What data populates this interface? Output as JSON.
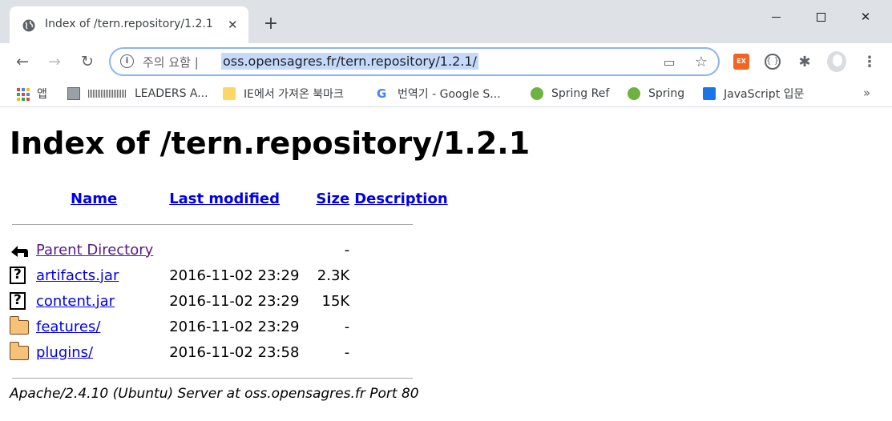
{
  "browser": {
    "tab_title": "Index of /tern.repository/1.2.1",
    "tab_close": "✕",
    "new_tab": "+",
    "security_label": "주의 요함  |",
    "url": "oss.opensagres.fr/tern.repository/1.2.1/",
    "back": "←",
    "forward": "→",
    "reload": "↻",
    "star": "☆",
    "cast": "▭",
    "ext_label": "EX",
    "puzzle": "✱",
    "menu": "⋮",
    "win_close": "✕"
  },
  "bookmarks": {
    "items": [
      {
        "label": "앱",
        "icon": "apps-grid-icon"
      },
      {
        "label": "LEADERS A...",
        "icon": "site-icon"
      },
      {
        "label": "IE에서 가져온 북마크",
        "icon": "folder-icon"
      },
      {
        "label": "번역기 - Google S...",
        "icon": "google-icon"
      },
      {
        "label": "Spring Ref",
        "icon": "spring-icon"
      },
      {
        "label": "Spring",
        "icon": "spring-icon"
      },
      {
        "label": "JavaScript 입문",
        "icon": "book-icon"
      }
    ],
    "overflow": "»",
    "google_letter": "G"
  },
  "colors": {
    "link": "#0000ee",
    "visited": "#551a8b",
    "ext_orange": "#f26522",
    "spring_green": "#6db33f"
  },
  "page": {
    "title": "Index of /tern.repository/1.2.1",
    "columns": {
      "name": "Name",
      "last_modified": "Last modified",
      "size": "Size",
      "description": "Description"
    },
    "parent": {
      "name": "Parent Directory",
      "size": "-"
    },
    "rows": [
      {
        "name": "artifacts.jar",
        "modified": "2016-11-02 23:29",
        "size": "2.3K",
        "icon": "unknown-file-icon"
      },
      {
        "name": "content.jar",
        "modified": "2016-11-02 23:29",
        "size": "15K",
        "icon": "unknown-file-icon"
      },
      {
        "name": "features/",
        "modified": "2016-11-02 23:29",
        "size": "-",
        "icon": "folder-icon"
      },
      {
        "name": "plugins/",
        "modified": "2016-11-02 23:58",
        "size": "-",
        "icon": "folder-icon"
      }
    ],
    "footer": "Apache/2.4.10 (Ubuntu) Server at oss.opensagres.fr Port 80"
  }
}
